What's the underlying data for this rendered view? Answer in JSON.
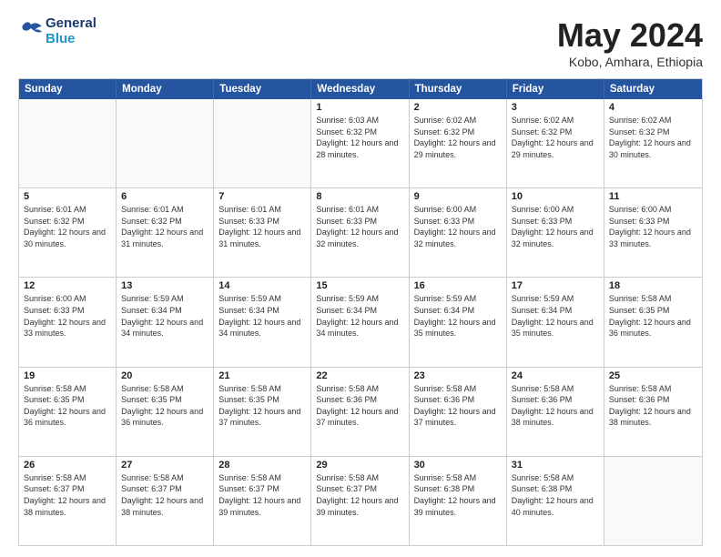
{
  "header": {
    "logo_text_general": "General",
    "logo_text_blue": "Blue",
    "month_title": "May 2024",
    "location": "Kobo, Amhara, Ethiopia"
  },
  "days_of_week": [
    "Sunday",
    "Monday",
    "Tuesday",
    "Wednesday",
    "Thursday",
    "Friday",
    "Saturday"
  ],
  "weeks": [
    [
      {
        "day": "",
        "info": ""
      },
      {
        "day": "",
        "info": ""
      },
      {
        "day": "",
        "info": ""
      },
      {
        "day": "1",
        "info": "Sunrise: 6:03 AM\nSunset: 6:32 PM\nDaylight: 12 hours and 28 minutes."
      },
      {
        "day": "2",
        "info": "Sunrise: 6:02 AM\nSunset: 6:32 PM\nDaylight: 12 hours and 29 minutes."
      },
      {
        "day": "3",
        "info": "Sunrise: 6:02 AM\nSunset: 6:32 PM\nDaylight: 12 hours and 29 minutes."
      },
      {
        "day": "4",
        "info": "Sunrise: 6:02 AM\nSunset: 6:32 PM\nDaylight: 12 hours and 30 minutes."
      }
    ],
    [
      {
        "day": "5",
        "info": "Sunrise: 6:01 AM\nSunset: 6:32 PM\nDaylight: 12 hours and 30 minutes."
      },
      {
        "day": "6",
        "info": "Sunrise: 6:01 AM\nSunset: 6:32 PM\nDaylight: 12 hours and 31 minutes."
      },
      {
        "day": "7",
        "info": "Sunrise: 6:01 AM\nSunset: 6:33 PM\nDaylight: 12 hours and 31 minutes."
      },
      {
        "day": "8",
        "info": "Sunrise: 6:01 AM\nSunset: 6:33 PM\nDaylight: 12 hours and 32 minutes."
      },
      {
        "day": "9",
        "info": "Sunrise: 6:00 AM\nSunset: 6:33 PM\nDaylight: 12 hours and 32 minutes."
      },
      {
        "day": "10",
        "info": "Sunrise: 6:00 AM\nSunset: 6:33 PM\nDaylight: 12 hours and 32 minutes."
      },
      {
        "day": "11",
        "info": "Sunrise: 6:00 AM\nSunset: 6:33 PM\nDaylight: 12 hours and 33 minutes."
      }
    ],
    [
      {
        "day": "12",
        "info": "Sunrise: 6:00 AM\nSunset: 6:33 PM\nDaylight: 12 hours and 33 minutes."
      },
      {
        "day": "13",
        "info": "Sunrise: 5:59 AM\nSunset: 6:34 PM\nDaylight: 12 hours and 34 minutes."
      },
      {
        "day": "14",
        "info": "Sunrise: 5:59 AM\nSunset: 6:34 PM\nDaylight: 12 hours and 34 minutes."
      },
      {
        "day": "15",
        "info": "Sunrise: 5:59 AM\nSunset: 6:34 PM\nDaylight: 12 hours and 34 minutes."
      },
      {
        "day": "16",
        "info": "Sunrise: 5:59 AM\nSunset: 6:34 PM\nDaylight: 12 hours and 35 minutes."
      },
      {
        "day": "17",
        "info": "Sunrise: 5:59 AM\nSunset: 6:34 PM\nDaylight: 12 hours and 35 minutes."
      },
      {
        "day": "18",
        "info": "Sunrise: 5:58 AM\nSunset: 6:35 PM\nDaylight: 12 hours and 36 minutes."
      }
    ],
    [
      {
        "day": "19",
        "info": "Sunrise: 5:58 AM\nSunset: 6:35 PM\nDaylight: 12 hours and 36 minutes."
      },
      {
        "day": "20",
        "info": "Sunrise: 5:58 AM\nSunset: 6:35 PM\nDaylight: 12 hours and 36 minutes."
      },
      {
        "day": "21",
        "info": "Sunrise: 5:58 AM\nSunset: 6:35 PM\nDaylight: 12 hours and 37 minutes."
      },
      {
        "day": "22",
        "info": "Sunrise: 5:58 AM\nSunset: 6:36 PM\nDaylight: 12 hours and 37 minutes."
      },
      {
        "day": "23",
        "info": "Sunrise: 5:58 AM\nSunset: 6:36 PM\nDaylight: 12 hours and 37 minutes."
      },
      {
        "day": "24",
        "info": "Sunrise: 5:58 AM\nSunset: 6:36 PM\nDaylight: 12 hours and 38 minutes."
      },
      {
        "day": "25",
        "info": "Sunrise: 5:58 AM\nSunset: 6:36 PM\nDaylight: 12 hours and 38 minutes."
      }
    ],
    [
      {
        "day": "26",
        "info": "Sunrise: 5:58 AM\nSunset: 6:37 PM\nDaylight: 12 hours and 38 minutes."
      },
      {
        "day": "27",
        "info": "Sunrise: 5:58 AM\nSunset: 6:37 PM\nDaylight: 12 hours and 38 minutes."
      },
      {
        "day": "28",
        "info": "Sunrise: 5:58 AM\nSunset: 6:37 PM\nDaylight: 12 hours and 39 minutes."
      },
      {
        "day": "29",
        "info": "Sunrise: 5:58 AM\nSunset: 6:37 PM\nDaylight: 12 hours and 39 minutes."
      },
      {
        "day": "30",
        "info": "Sunrise: 5:58 AM\nSunset: 6:38 PM\nDaylight: 12 hours and 39 minutes."
      },
      {
        "day": "31",
        "info": "Sunrise: 5:58 AM\nSunset: 6:38 PM\nDaylight: 12 hours and 40 minutes."
      },
      {
        "day": "",
        "info": ""
      }
    ]
  ]
}
